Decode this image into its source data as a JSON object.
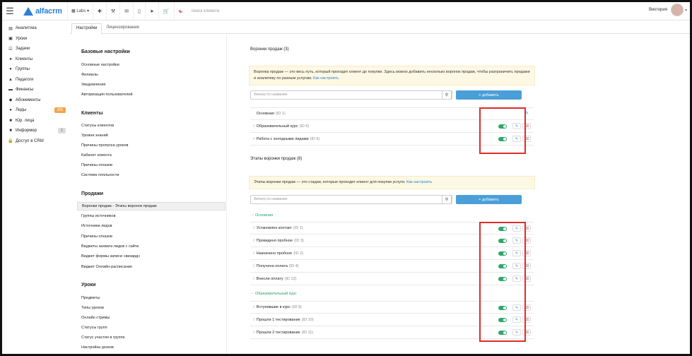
{
  "topbar": {
    "logo": "alfacrm",
    "labs": "Labs",
    "icons": [
      "plus-icon",
      "wrench-icon",
      "mail-icon",
      "phone-icon",
      "send-icon",
      "cart-icon",
      "user-icon"
    ],
    "search_placeholder": "поиск клиента",
    "user_name": "Виктория"
  },
  "sidebar": {
    "items": [
      {
        "icon": "chart-icon",
        "label": "Аналитика"
      },
      {
        "icon": "calendar-icon",
        "label": "Уроки"
      },
      {
        "icon": "tasks-icon",
        "label": "Задачи"
      },
      {
        "icon": "user-icon",
        "label": "Клиенты"
      },
      {
        "icon": "users-icon",
        "label": "Группы"
      },
      {
        "icon": "teacher-icon",
        "label": "Педагоги"
      },
      {
        "icon": "money-icon",
        "label": "Финансы"
      },
      {
        "icon": "tag-icon",
        "label": "Абонементы"
      },
      {
        "icon": "lead-icon",
        "label": "Лиды",
        "badge": "155"
      },
      {
        "icon": "building-icon",
        "label": "Юр. лица"
      },
      {
        "icon": "info-icon",
        "label": "Информер",
        "badge": "1"
      },
      {
        "icon": "lock-icon",
        "label": "Доступ в CRM"
      }
    ]
  },
  "tabs": [
    {
      "label": "Настройки",
      "active": true
    },
    {
      "label": "Лицензирование",
      "active": false
    }
  ],
  "menu": {
    "sections": [
      {
        "title": "Базовые настройки",
        "items": [
          "Основные настройки",
          "Филиалы",
          "Уведомления",
          "Авторизация пользователей"
        ]
      },
      {
        "title": "Клиенты",
        "items": [
          "Статусы клиентов",
          "Уровни знаний",
          "Причины пропуска уроков",
          "Кабинет клиента",
          "Причины отказов",
          "Система лояльности"
        ]
      },
      {
        "title": "Продажи",
        "items": [
          "Воронки продаж - Этапы воронок продаж",
          "Группы источников",
          "Источники лидов",
          "Причины отказов",
          "Виджеты захвата лидов с сайта",
          "Виджет формы записи «визард»",
          "Виджет Онлайн-расписание"
        ]
      },
      {
        "title": "Уроки",
        "items": [
          "Предметы",
          "Типы уроков",
          "Онлайн стримы",
          "Статусы групп",
          "Статус участия в группе",
          "Настройка уроков"
        ]
      }
    ],
    "active_item": "Воронки продаж - Этапы воронок продаж"
  },
  "funnels": {
    "title": "Воронки продаж (3)",
    "info": "Воронка продаж — это весь путь, который проходит клиент до покупки. Здесь можно добавить несколько воронок продаж, чтобы разграничить продажи и аналитику по разным услугам.",
    "info_link": "Как настроить",
    "filter_placeholder": "Фильтр по названию",
    "add_label": "+ добавить",
    "rows": [
      {
        "name": "Основная",
        "id": "(ID 1)",
        "toggle": false,
        "delete": false
      },
      {
        "name": "Образовательный курс",
        "id": "(ID 5)",
        "toggle": true,
        "delete": true
      },
      {
        "name": "Работа с холодными лидами",
        "id": "(ID 6)",
        "toggle": true,
        "delete": true
      }
    ]
  },
  "stages": {
    "title": "Этапы воронки продаж (8)",
    "info": "Этапы воронки продаж — это стадии, которые проходит клиент для покупки услуги.",
    "info_link": "Как настроить",
    "filter_placeholder": "Фильтр по названию",
    "add_label": "+ добавить",
    "groups": [
      {
        "label": "Основная",
        "rows": [
          {
            "name": "Установлен контакт",
            "id": "(ID 1)"
          },
          {
            "name": "Проведено пробное",
            "id": "(ID 3)"
          },
          {
            "name": "Назначено пробное",
            "id": "(ID 2)"
          },
          {
            "name": "Получена оплата",
            "id": "(ID 4)"
          },
          {
            "name": "Внесли оплату",
            "id": "(ID 12)"
          }
        ]
      },
      {
        "label": "Образовательный курс",
        "rows": [
          {
            "name": "Вступившие в курс",
            "id": "(ID 9)"
          },
          {
            "name": "Прошли 1 тестирование",
            "id": "(ID 10)"
          },
          {
            "name": "Прошли 2 тестирование",
            "id": "(ID 11)"
          }
        ]
      }
    ]
  },
  "colors": {
    "accent": "#2b7fd4",
    "button": "#4a9fd8",
    "toggle": "#2ea86b",
    "highlight": "#e12b2b",
    "info_bg": "#fcf8e3"
  }
}
